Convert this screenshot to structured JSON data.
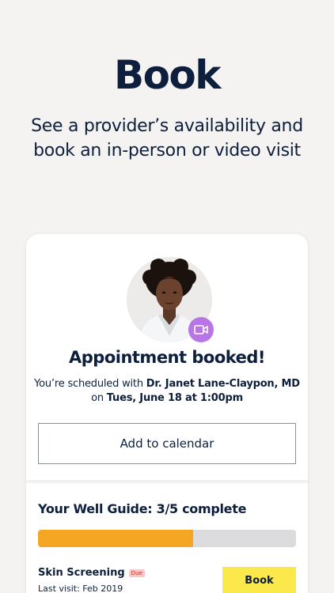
{
  "hero": {
    "title": "Book",
    "subtitle_line1": "See a provider’s availability and",
    "subtitle_line2": "book an in-person or video visit"
  },
  "card": {
    "booked_title": "Appointment booked!",
    "line1_prefix": "You’re scheduled with ",
    "doctor": "Dr. Janet Lane-Claypon, MD",
    "line2_prefix": "on ",
    "datetime": "Tues, June 18 at 1:00pm",
    "add_calendar_label": "Add to calendar",
    "video_icon": "video-camera-icon"
  },
  "well_guide": {
    "title": "Your Well Guide: 3/5 complete",
    "progress_fraction": 0.6,
    "item": {
      "name": "Skin Screening",
      "badge": "Due",
      "last_visit": "Last visit: Feb 2019",
      "action_label": "Book"
    }
  },
  "colors": {
    "background": "#f5f3f1",
    "navy": "#0d1f3c",
    "progress": "#f5a623",
    "video_badge": "#b775e8",
    "book_button": "#fbe84a"
  }
}
